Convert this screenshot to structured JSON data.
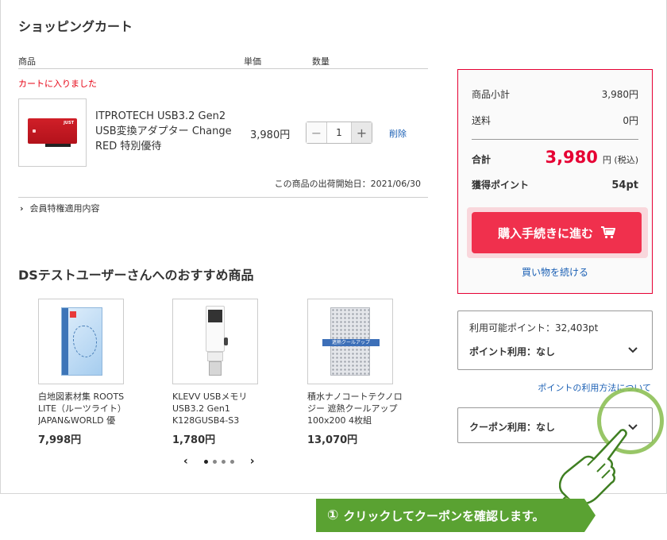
{
  "page": {
    "title": "ショッピングカート"
  },
  "cart": {
    "col_product": "商品",
    "col_unit_price": "単価",
    "col_quantity": "数量",
    "added_message": "カートに入りました",
    "item": {
      "name": "ITPROTECH USB3.2 Gen2 USB変換アダプター Change RED 特別優待",
      "thumb_label": "JUST",
      "price": "3,980円",
      "quantity": "1",
      "minus": "−",
      "plus": "+",
      "delete_label": "削除",
      "ship_date": "この商品の出荷開始日：2021/06/30"
    },
    "member_benefits": "会員特権適用内容"
  },
  "recommend": {
    "title": "DSテストユーザーさんへのおすすめ商品",
    "items": [
      {
        "name": "白地図素材集 ROOTS LITE（ルーツライト）JAPAN&WORLD 優",
        "price": "7,998円"
      },
      {
        "name": "KLEVV USBメモリ USB3.2 Gen1 K128GUSB4-S3",
        "price": "1,780円"
      },
      {
        "name": "積水ナノコートテクノロジー 遮熱クールアップ 100x200 4枚組",
        "price": "13,070円",
        "thumb_banner": "遮熱クールアップ"
      }
    ],
    "carousel": {
      "prev": "‹",
      "next": "›",
      "pages": 4,
      "active": 1
    }
  },
  "summary": {
    "subtotal_label": "商品小計",
    "subtotal_value": "3,980円",
    "shipping_label": "送料",
    "shipping_value": "0円",
    "total_label": "合計",
    "total_value": "3,980",
    "total_unit": "円 (税込)",
    "points_label": "獲得ポイント",
    "points_value": "54pt",
    "checkout_label": "購入手続きに進む",
    "continue_label": "買い物を続ける",
    "accent_color": "#e60033"
  },
  "points": {
    "available": "利用可能ポイント：32,403pt",
    "use_label": "ポイント利用：なし",
    "help_link": "ポイントの利用方法について"
  },
  "coupon": {
    "use_label": "クーポン利用：なし"
  },
  "callout": {
    "number": "①",
    "text": "クリックしてクーポンを確認します。",
    "color": "#5aa232"
  }
}
